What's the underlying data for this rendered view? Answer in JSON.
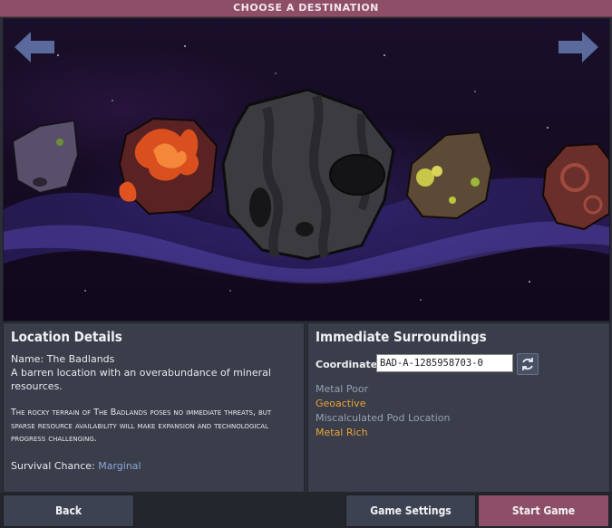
{
  "window": {
    "title": "CHOOSE A DESTINATION"
  },
  "navigation": {
    "prev_icon": "arrow-left-icon",
    "next_icon": "arrow-right-icon"
  },
  "location_details": {
    "heading": "Location Details",
    "name_label": "Name:",
    "name_value": "The Badlands",
    "summary": "A barren location with an overabundance of mineral resources.",
    "description": "The rocky terrain of The Badlands poses no immediate threats, but sparse resource availability will make expansion and technological progress challenging.",
    "survival_label": "Survival Chance:",
    "survival_value": "Marginal"
  },
  "surroundings": {
    "heading": "Immediate Surroundings",
    "coordinates_label": "Coordinates:",
    "coordinates_value": "BAD-A-1285958703-0",
    "refresh_icon": "refresh-icon",
    "traits": [
      {
        "label": "Metal Poor",
        "color": "#98a0ae"
      },
      {
        "label": "Geoactive",
        "color": "#e9a23a"
      },
      {
        "label": "Miscalculated Pod Location",
        "color": "#98a0ae"
      },
      {
        "label": "Metal Rich",
        "color": "#e9a23a"
      }
    ]
  },
  "buttons": {
    "back": "Back",
    "settings": "Game Settings",
    "start": "Start Game"
  },
  "colors": {
    "accent": "#8f4e67",
    "panel": "#3a3e4a",
    "link": "#8ba4d8",
    "warning": "#e9a23a"
  }
}
